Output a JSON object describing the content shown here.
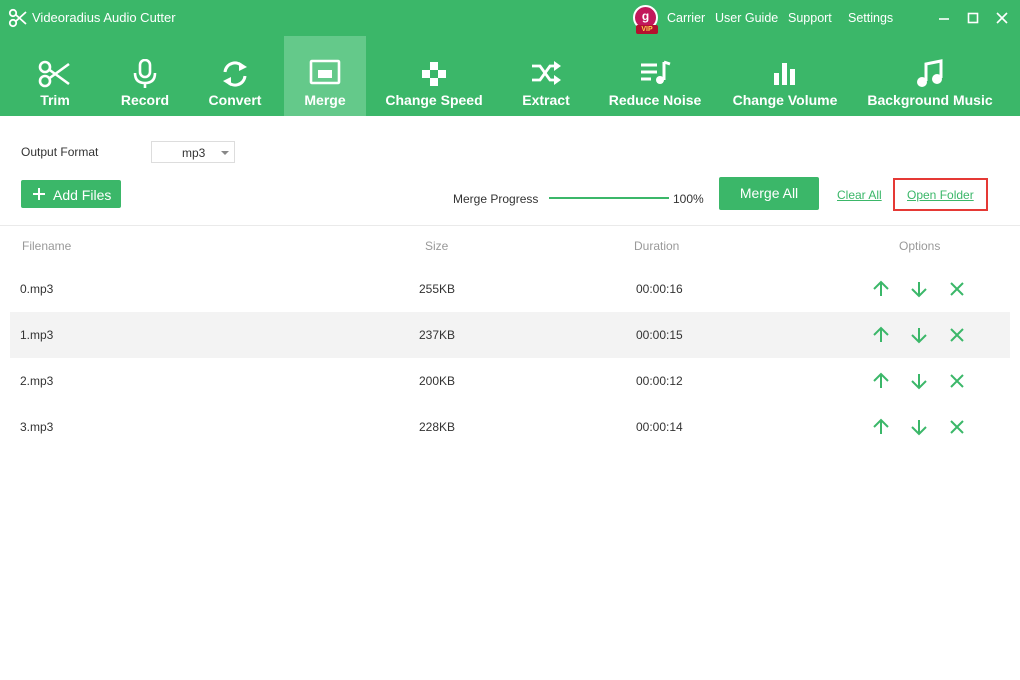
{
  "app": {
    "title": "Videoradius Audio Cutter"
  },
  "vip": {
    "avatar_letter": "g",
    "badge": "VIP"
  },
  "top_nav": {
    "carrier": "Carrier",
    "user_guide": "User Guide",
    "support": "Support",
    "settings": "Settings"
  },
  "tools": [
    {
      "label": "Trim",
      "icon": "scissors-icon"
    },
    {
      "label": "Record",
      "icon": "microphone-icon"
    },
    {
      "label": "Convert",
      "icon": "refresh-icon"
    },
    {
      "label": "Merge",
      "icon": "merge-icon",
      "active": true
    },
    {
      "label": "Change Speed",
      "icon": "gamepad-icon"
    },
    {
      "label": "Extract",
      "icon": "shuffle-icon"
    },
    {
      "label": "Reduce Noise",
      "icon": "music-list-icon"
    },
    {
      "label": "Change Volume",
      "icon": "bar-chart-icon"
    },
    {
      "label": "Background Music",
      "icon": "music-note-icon"
    }
  ],
  "controls": {
    "output_format_label": "Output Format",
    "output_format_value": "mp3",
    "add_files": "Add Files",
    "merge_progress_label": "Merge Progress",
    "merge_progress_value": "100%",
    "merge_progress_fraction": 1.0,
    "merge_all": "Merge All",
    "clear_all": "Clear All",
    "open_folder": "Open Folder"
  },
  "table": {
    "headers": {
      "filename": "Filename",
      "size": "Size",
      "duration": "Duration",
      "options": "Options"
    },
    "rows": [
      {
        "filename": "0.mp3",
        "size": "255KB",
        "duration": "00:00:16"
      },
      {
        "filename": "1.mp3",
        "size": "237KB",
        "duration": "00:00:15"
      },
      {
        "filename": "2.mp3",
        "size": "200KB",
        "duration": "00:00:12"
      },
      {
        "filename": "3.mp3",
        "size": "228KB",
        "duration": "00:00:14"
      }
    ]
  },
  "colors": {
    "brand_green": "#3bb769",
    "active_tab": "#64c98a",
    "highlight_red": "#e53935",
    "vip_red": "#c2185b"
  }
}
